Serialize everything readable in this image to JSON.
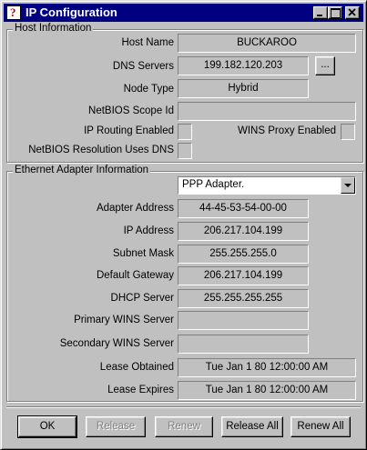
{
  "window": {
    "title": "IP Configuration",
    "icon_name": "app-icon",
    "icon_glyph": "?"
  },
  "host": {
    "legend": "Host Information",
    "host_name_label": "Host Name",
    "host_name": "BUCKAROO",
    "dns_label": "DNS Servers",
    "dns": "199.182.120.203",
    "dns_more": "...",
    "node_type_label": "Node Type",
    "node_type": "Hybrid",
    "netbios_scope_label": "NetBIOS Scope Id",
    "netbios_scope": "",
    "ip_routing_label": "IP Routing Enabled",
    "wins_proxy_label": "WINS Proxy Enabled",
    "netbios_dns_label": "NetBIOS Resolution Uses DNS"
  },
  "adapter": {
    "legend": "Ethernet  Adapter Information",
    "selected": "PPP Adapter.",
    "address_label": "Adapter Address",
    "address": "44-45-53-54-00-00",
    "ip_label": "IP Address",
    "ip": "206.217.104.199",
    "subnet_label": "Subnet Mask",
    "subnet": "255.255.255.0",
    "gateway_label": "Default Gateway",
    "gateway": "206.217.104.199",
    "dhcp_label": "DHCP Server",
    "dhcp": "255.255.255.255",
    "primary_wins_label": "Primary WINS Server",
    "primary_wins": "",
    "secondary_wins_label": "Secondary WINS Server",
    "secondary_wins": "",
    "lease_obtained_label": "Lease Obtained",
    "lease_obtained": "Tue Jan 1 80 12:00:00 AM",
    "lease_expires_label": "Lease Expires",
    "lease_expires": "Tue Jan 1 80 12:00:00 AM"
  },
  "buttons": {
    "ok": "OK",
    "release": "Release",
    "renew": "Renew",
    "release_all": "Release All",
    "renew_all": "Renew All"
  }
}
